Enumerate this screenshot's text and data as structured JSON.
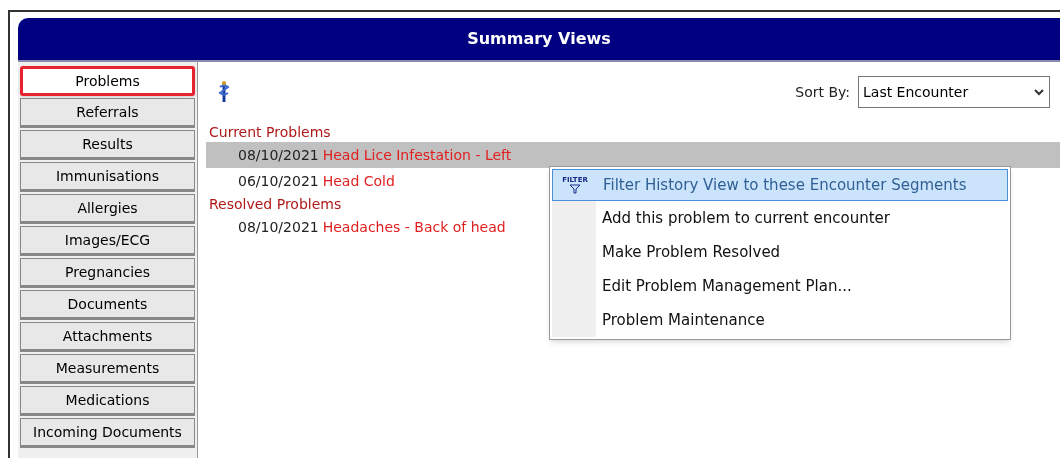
{
  "window": {
    "title": "Summary Views"
  },
  "sidebar": {
    "items": [
      {
        "label": "Problems",
        "selected": true
      },
      {
        "label": "Referrals",
        "selected": false
      },
      {
        "label": "Results",
        "selected": false
      },
      {
        "label": "Immunisations",
        "selected": false
      },
      {
        "label": "Allergies",
        "selected": false
      },
      {
        "label": "Images/ECG",
        "selected": false
      },
      {
        "label": "Pregnancies",
        "selected": false
      },
      {
        "label": "Documents",
        "selected": false
      },
      {
        "label": "Attachments",
        "selected": false
      },
      {
        "label": "Measurements",
        "selected": false
      },
      {
        "label": "Medications",
        "selected": false
      },
      {
        "label": "Incoming Documents",
        "selected": false
      }
    ]
  },
  "sort": {
    "label": "Sort By:",
    "value": "Last Encounter"
  },
  "groups": [
    {
      "heading": "Current Problems",
      "problems": [
        {
          "date": "08/10/2021",
          "name": "Head Lice Infestation - Left",
          "selected": true
        },
        {
          "date": "06/10/2021",
          "name": "Head Cold",
          "selected": false
        }
      ]
    },
    {
      "heading": "Resolved Problems",
      "problems": [
        {
          "date": "08/10/2021",
          "name": "Headaches - Back of head",
          "selected": false
        }
      ]
    }
  ],
  "context_menu": {
    "items": [
      {
        "label": "Filter History View to these Encounter Segments",
        "icon_text": "FILTER",
        "selected": true
      },
      {
        "label": "Add this problem to current encounter",
        "selected": false
      },
      {
        "label": "Make Problem Resolved",
        "selected": false
      },
      {
        "label": "Edit Problem Management Plan...",
        "selected": false
      },
      {
        "label": "Problem Maintenance",
        "selected": false
      }
    ]
  }
}
